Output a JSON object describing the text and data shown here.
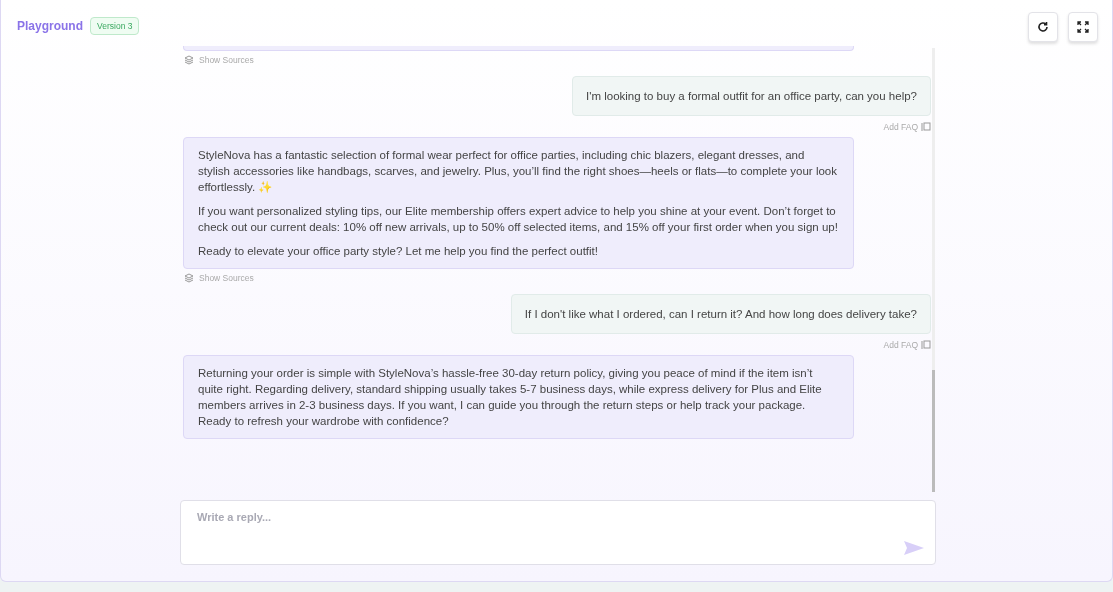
{
  "header": {
    "title": "Playground",
    "version_badge": "Version 3"
  },
  "messages": [
    {
      "kind": "bot",
      "show_sources": "Show Sources"
    },
    {
      "kind": "user",
      "text": "I'm looking to buy a formal outfit for an office party, can you help?",
      "add_faq": "Add FAQ"
    },
    {
      "kind": "bot",
      "paragraphs": [
        "StyleNova has a fantastic selection of formal wear perfect for office parties, including chic blazers, elegant dresses, and stylish accessories like handbags, scarves, and jewelry. Plus, you’ll find the right shoes—heels or flats—to complete your look effortlessly. ✨",
        "If you want personalized styling tips, our Elite membership offers expert advice to help you shine at your event. Don’t forget to check out our current deals: 10% off new arrivals, up to 50% off selected items, and 15% off your first order when you sign up!",
        "Ready to elevate your office party style? Let me help you find the perfect outfit!"
      ],
      "show_sources": "Show Sources"
    },
    {
      "kind": "user",
      "text": "If I don't like what I ordered, can I return it? And how long does delivery take?",
      "add_faq": "Add FAQ"
    },
    {
      "kind": "bot",
      "paragraphs": [
        "Returning your order is simple with StyleNova’s hassle-free 30-day return policy, giving you peace of mind if the item isn’t quite right. Regarding delivery, standard shipping usually takes 5-7 business days, while express delivery for Plus and Elite members arrives in 2-3 business days. If you want, I can guide you through the return steps or help track your package. Ready to refresh your wardrobe with confidence?"
      ]
    }
  ],
  "reply": {
    "placeholder": "Write a reply..."
  }
}
